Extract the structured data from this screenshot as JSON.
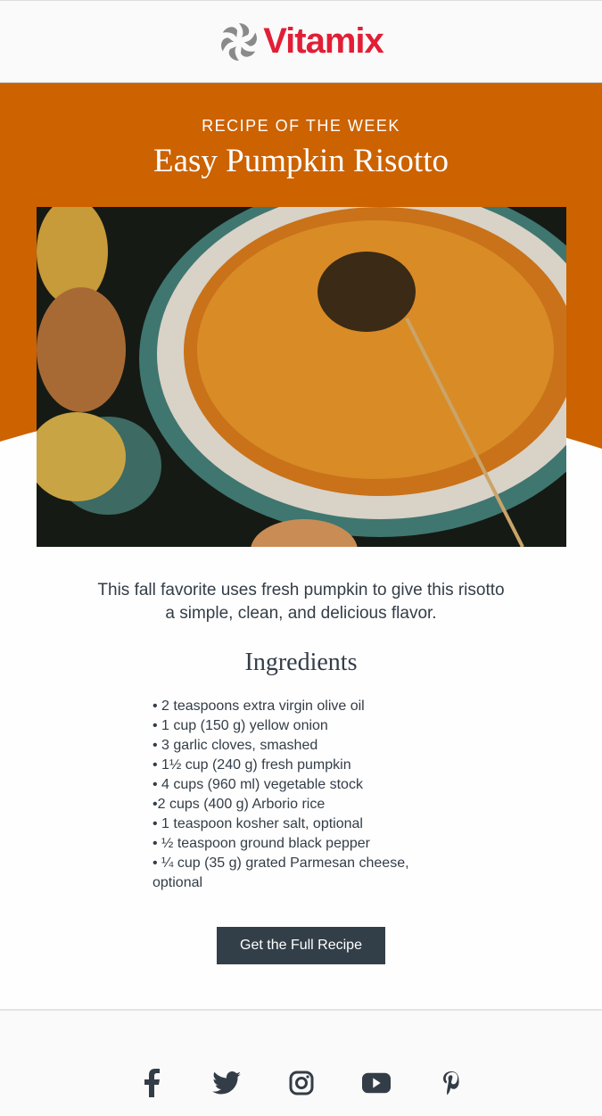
{
  "brand": {
    "name": "Vitamix",
    "accent": "#e21e36",
    "hero_color": "#cc6200"
  },
  "hero": {
    "eyebrow": "RECIPE OF THE WEEK",
    "title": "Easy Pumpkin Risotto"
  },
  "intro": "This fall favorite uses fresh pumpkin to give this risotto a simple, clean, and delicious flavor.",
  "ingredients": {
    "heading": "Ingredients",
    "items": [
      "• 2 teaspoons extra virgin olive oil",
      "• 1 cup (150 g) yellow onion",
      "• 3 garlic cloves, smashed",
      "• 1½ cup (240 g) fresh pumpkin",
      "• 4 cups (960 ml) vegetable stock",
      "•2 cups (400 g) Arborio rice",
      "• 1 teaspoon kosher salt, optional",
      "• ½ teaspoon ground black pepper",
      "• ¼ cup (35 g) grated Parmesan cheese, optional"
    ]
  },
  "cta": "Get the Full Recipe",
  "social": [
    "facebook-icon",
    "twitter-icon",
    "instagram-icon",
    "youtube-icon",
    "pinterest-icon"
  ]
}
